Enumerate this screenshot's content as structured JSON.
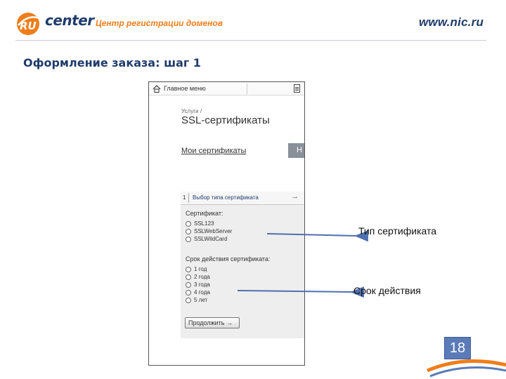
{
  "header": {
    "logo_prefix": "RU",
    "logo_suffix": "center",
    "tagline": "Центр регистрации доменов",
    "site": "www.nic.ru"
  },
  "slide": {
    "title": "Оформление заказа: шаг 1",
    "page_number": "18"
  },
  "phone": {
    "topbar": {
      "main_menu": "Главное меню"
    },
    "breadcrumb": "Услуги /",
    "heading": "SSL-сертификаты",
    "my_certs_link": "Мои сертификаты",
    "new_tab": "Н",
    "step": {
      "number": "1",
      "label": "Выбор типа сертификата",
      "arrow": "→"
    },
    "certificate_group": {
      "title": "Сертификат:",
      "options": [
        "SSL123",
        "SSLWebServer",
        "SSLWildCard"
      ]
    },
    "term_group": {
      "title": "Срок действия сертификата:",
      "options": [
        "1 год",
        "2 года",
        "3 года",
        "4 года",
        "5 лет"
      ]
    },
    "continue_button": "Продолжить →"
  },
  "callouts": {
    "certificate_type": "Тип сертификата",
    "validity_period": "Срок действия"
  },
  "colors": {
    "brand_blue": "#1f3c6b",
    "brand_orange": "#f07d1a",
    "page_badge": "#5b7bb8",
    "callout_arrow": "#4f6fae"
  }
}
